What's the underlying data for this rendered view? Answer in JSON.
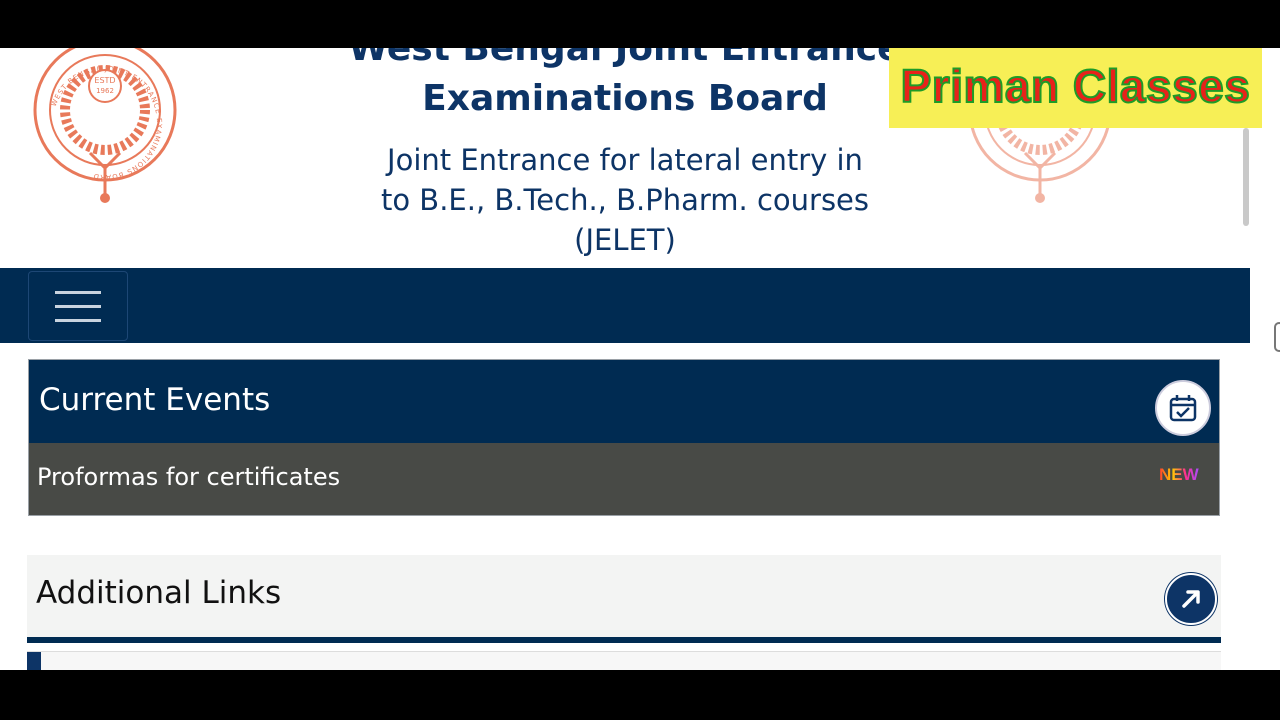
{
  "header": {
    "title_line1": "West Bengal Joint Entrance",
    "title_line2": "Examinations Board",
    "subtitle_line1": "Joint Entrance for lateral entry in",
    "subtitle_line2": "to B.E., B.Tech., B.Pharm. courses",
    "subtitle_line3": "(JELET)",
    "logo_text": {
      "estd": "ESTD",
      "year": "1962",
      "ring": "WEST BENGAL JOINT ENTRANCE EXAMINATIONS BOARD"
    }
  },
  "watermark": {
    "text": "Priman Classes"
  },
  "navbar": {
    "menu_icon": "hamburger-menu-icon"
  },
  "current_events": {
    "title": "Current Events",
    "icon": "calendar-check-icon",
    "items": [
      {
        "label": "Proformas for certificates",
        "badge": "NEW"
      }
    ]
  },
  "additional_links": {
    "title": "Additional Links",
    "icon": "external-link-icon"
  },
  "colors": {
    "navy": "#002b52",
    "title_blue": "#0d3466",
    "event_row": "#484a46",
    "logo_orange": "#e8795a",
    "watermark_bg": "#f7ef56",
    "watermark_text": "#e8221a",
    "watermark_outline": "#1e9b27"
  }
}
